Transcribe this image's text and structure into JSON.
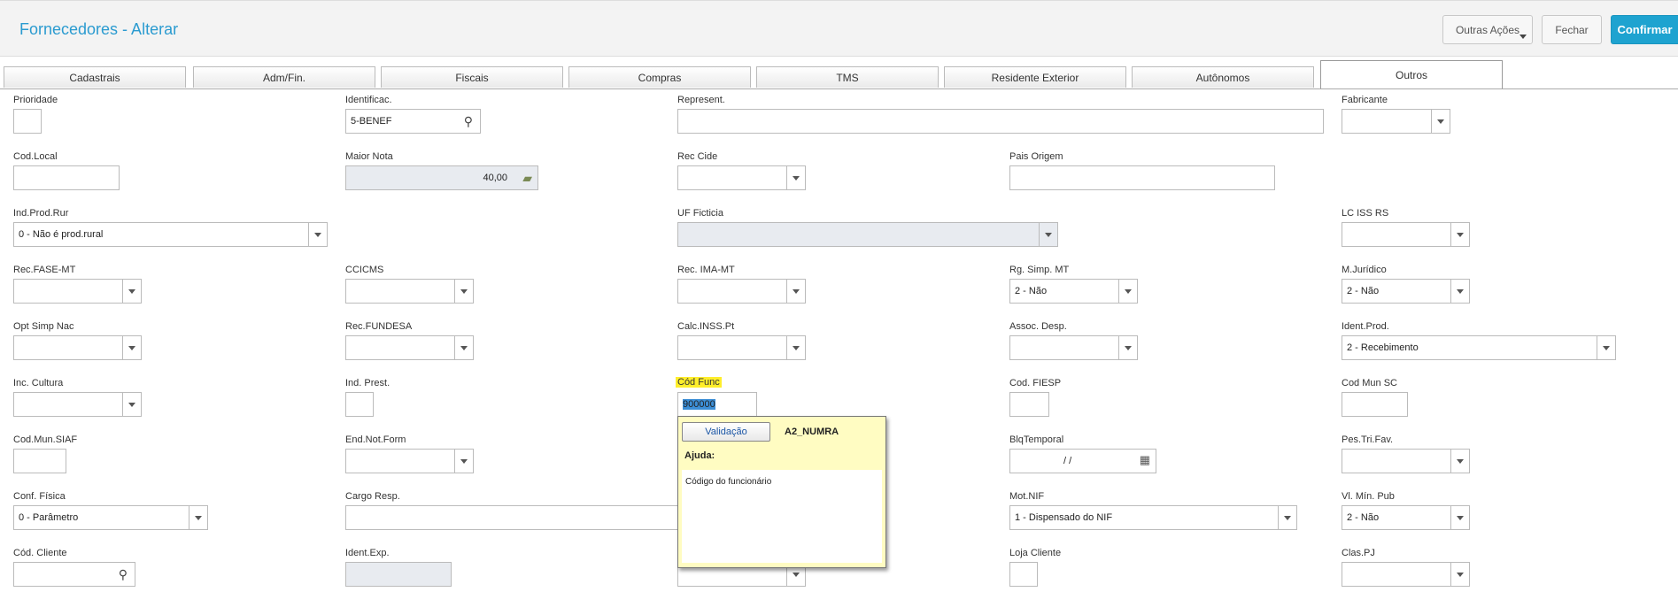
{
  "header": {
    "title": "Fornecedores - Alterar",
    "buttons": {
      "outras": "Outras Ações",
      "fechar": "Fechar",
      "confirmar": "Confirmar"
    }
  },
  "tabs": [
    "Cadastrais",
    "Adm/Fin.",
    "Fiscais",
    "Compras",
    "TMS",
    "Residente Exterior",
    "Autônomos",
    "Outros"
  ],
  "active_tab": "Outros",
  "fields": {
    "prioridade": {
      "label": "Prioridade",
      "value": ""
    },
    "identificac": {
      "label": "Identificac.",
      "value": "5-BENEF"
    },
    "represent": {
      "label": "Represent.",
      "value": ""
    },
    "fabricante": {
      "label": "Fabricante",
      "value": ""
    },
    "cod_local": {
      "label": "Cod.Local",
      "value": ""
    },
    "maior_nota": {
      "label": "Maior Nota",
      "value": "40,00"
    },
    "rec_cide": {
      "label": "Rec Cide",
      "value": ""
    },
    "pais_origem": {
      "label": "Pais Origem",
      "value": ""
    },
    "ind_prod_rur": {
      "label": "Ind.Prod.Rur",
      "value": "0 - Não é prod.rural"
    },
    "uf_ficticia": {
      "label": "UF Ficticia",
      "value": ""
    },
    "lc_iss_rs": {
      "label": "LC ISS RS",
      "value": ""
    },
    "rec_fase_mt": {
      "label": "Rec.FASE-MT",
      "value": ""
    },
    "ccicms": {
      "label": "CCICMS",
      "value": ""
    },
    "rec_ima_mt": {
      "label": "Rec. IMA-MT",
      "value": ""
    },
    "rg_simp_mt": {
      "label": "Rg. Simp. MT",
      "value": "2 - Não"
    },
    "m_juridico": {
      "label": "M.Jurídico",
      "value": "2 - Não"
    },
    "opt_simp_nac": {
      "label": "Opt Simp Nac",
      "value": ""
    },
    "rec_fundesa": {
      "label": "Rec.FUNDESA",
      "value": ""
    },
    "calc_inss_pt": {
      "label": "Calc.INSS.Pt",
      "value": ""
    },
    "assoc_desp": {
      "label": "Assoc. Desp.",
      "value": ""
    },
    "ident_prod": {
      "label": "Ident.Prod.",
      "value": "2 - Recebimento"
    },
    "inc_cultura": {
      "label": "Inc. Cultura",
      "value": ""
    },
    "ind_prest": {
      "label": "Ind. Prest.",
      "value": ""
    },
    "cod_func": {
      "label": "Cód Func",
      "value": "900000"
    },
    "cod_fiesp": {
      "label": "Cod. FIESP",
      "value": ""
    },
    "cod_mun_sc": {
      "label": "Cod Mun SC",
      "value": ""
    },
    "cod_mun_siaf": {
      "label": "Cod.Mun.SIAF",
      "value": ""
    },
    "end_not_form": {
      "label": "End.Not.Form",
      "value": ""
    },
    "blq_temporal": {
      "label": "BlqTemporal",
      "value": " /  /"
    },
    "pes_tri_fav": {
      "label": "Pes.Tri.Fav.",
      "value": ""
    },
    "conf_fisica": {
      "label": "Conf. Física",
      "value": "0 - Parâmetro"
    },
    "cargo_resp": {
      "label": "Cargo Resp.",
      "value": ""
    },
    "mot_nif": {
      "label": "Mot.NIF",
      "value": "1 - Dispensado do NIF"
    },
    "vl_min_pub": {
      "label": "Vl. Mín. Pub",
      "value": "2 - Não"
    },
    "cod_cliente": {
      "label": "Cód. Cliente",
      "value": ""
    },
    "ident_exp": {
      "label": "Ident.Exp.",
      "value": ""
    },
    "loja_cliente": {
      "label": "Loja Cliente",
      "value": ""
    },
    "clas_pj": {
      "label": "Clas.PJ",
      "value": ""
    }
  },
  "tooltip": {
    "button": "Validação",
    "code": "A2_NUMRA",
    "ajuda_label": "Ajuda:",
    "text": "Código do funcionário"
  },
  "icons": [
    "search-icon",
    "money-icon",
    "calendar-icon",
    "dropdown-arrow-icon"
  ]
}
